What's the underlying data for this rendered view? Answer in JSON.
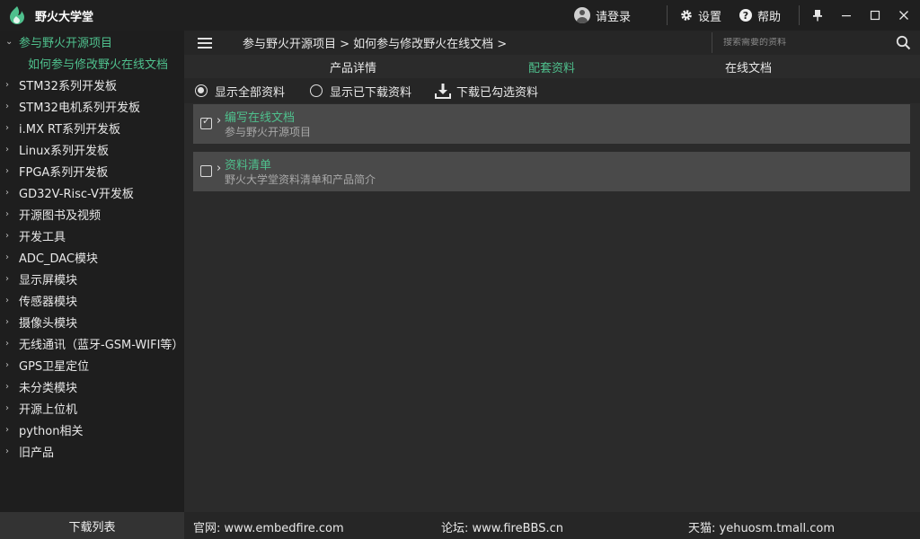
{
  "app": {
    "title": "野火大学堂",
    "brand_color": "#4fc08d"
  },
  "titlebar": {
    "login_label": "请登录",
    "settings_label": "设置",
    "help_label": "帮助",
    "help_glyph": "?",
    "pin_glyph": "📌",
    "minimize_glyph": "—",
    "maximize_glyph": "☐",
    "close_glyph": "✕"
  },
  "sidebar": {
    "expanded": {
      "label": "参与野火开源项目",
      "child": "如何参与修改野火在线文档"
    },
    "items": [
      "STM32系列开发板",
      "STM32电机系列开发板",
      "i.MX RT系列开发板",
      "Linux系列开发板",
      "FPGA系列开发板",
      "GD32V-Risc-V开发板",
      "开源图书及视频",
      "开发工具",
      "ADC_DAC模块",
      "显示屏模块",
      "传感器模块",
      "摄像头模块",
      "无线通讯（蓝牙-GSM-WIFI等）",
      "GPS卫星定位",
      "未分类模块",
      "开源上位机",
      "python相关",
      "旧产品"
    ],
    "footer_label": "下载列表"
  },
  "navbar": {
    "breadcrumb": "参与野火开源项目  >  如何参与修改野火在线文档  >",
    "search_placeholder": "搜索需要的资料"
  },
  "tabs": [
    {
      "label": "产品详情",
      "active": false
    },
    {
      "label": "配套资料",
      "active": true
    },
    {
      "label": "在线文档",
      "active": false
    }
  ],
  "toolbar": {
    "show_all": "显示全部资料",
    "show_downloaded": "显示已下载资料",
    "download_checked": "下载已勾选资料"
  },
  "cards": [
    {
      "title": "编写在线文档",
      "subtitle": "参与野火开源项目",
      "checked": true
    },
    {
      "title": "资料清单",
      "subtitle": "野火大学堂资料清单和产品简介",
      "checked": false
    }
  ],
  "footer": {
    "site": "官网:   www.embedfire.com",
    "forum": "论坛:   www.fireBBS.cn",
    "tmall": "天猫:   yehuosm.tmall.com"
  }
}
